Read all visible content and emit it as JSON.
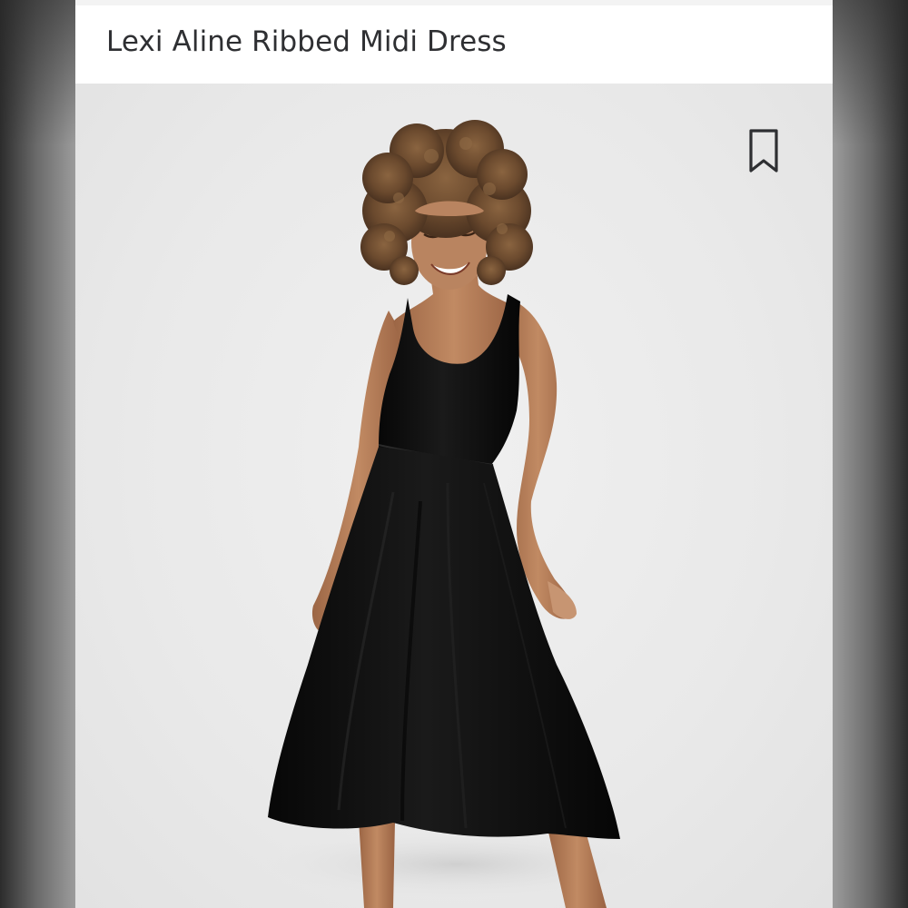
{
  "product": {
    "title": "Lexi Aline Ribbed Midi Dress"
  },
  "gallery": {
    "save_icon": "bookmark-icon",
    "image_subject": "model-wearing-black-midi-dress"
  },
  "colors": {
    "header_bg": "#ffffff",
    "title_text": "#2e2f32",
    "gallery_bg": "#ebebeb",
    "dress": "#0d0d0d",
    "hair": "#6b4a2e",
    "skin": "#b07a57"
  }
}
